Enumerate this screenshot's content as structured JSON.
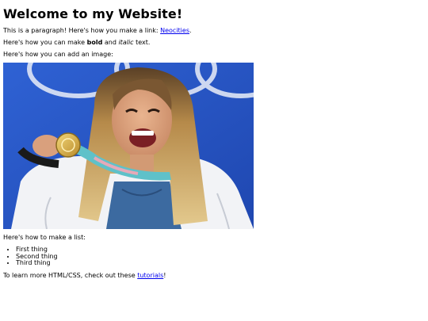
{
  "heading": "Welcome to my Website!",
  "para_link": {
    "before": "This is a paragraph! Here's how you make a link: ",
    "link_text": "Neocities",
    "after": "."
  },
  "para_format": {
    "before": "Here's how you can make ",
    "bold": "bold",
    "middle": " and ",
    "italic": "italic",
    "after": " text."
  },
  "para_image": "Here's how you can add an image:",
  "image": {
    "alt": ""
  },
  "para_list": "Here's how to make a list:",
  "list_items": [
    "First thing",
    "Second thing",
    "Third thing"
  ],
  "para_tutorials": {
    "before": "To learn more HTML/CSS, check out these ",
    "link_text": "tutorials",
    "after": "!"
  }
}
